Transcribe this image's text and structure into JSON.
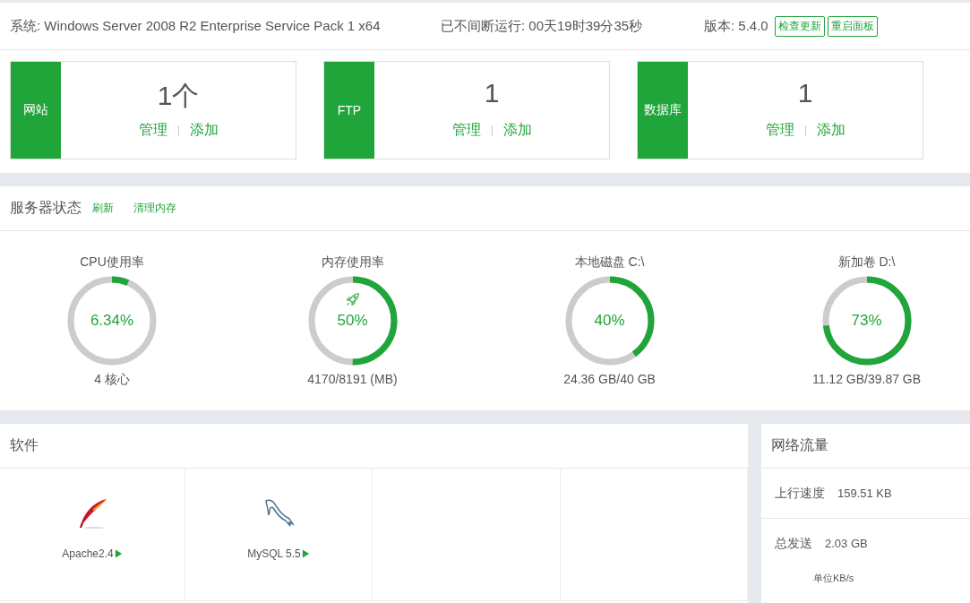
{
  "top_bar": {
    "system": "系统: Windows Server 2008 R2 Enterprise Service Pack 1 x64",
    "uptime": "已不间断运行: 00天19时39分35秒",
    "version": "版本: 5.4.0",
    "buttons": [
      "检查更新",
      "重启面板"
    ]
  },
  "summary_cards": [
    {
      "label": "网站",
      "count": "1个",
      "links": [
        "管理",
        "添加"
      ]
    },
    {
      "label": "FTP",
      "count": "1",
      "links": [
        "管理",
        "添加"
      ]
    },
    {
      "label": "数据库",
      "count": "1",
      "links": [
        "管理",
        "添加"
      ]
    }
  ],
  "server_status": {
    "title": "服务器状态",
    "actions": [
      "刷新",
      "清理内存"
    ],
    "gauges": [
      {
        "title": "CPU使用率",
        "level": 0.0634,
        "reading": "6.34%",
        "detail": "4 核心",
        "kind": "plain"
      },
      {
        "title": "内存使用率",
        "level": 0.5,
        "reading": "50%",
        "detail": "4170/8191 (MB)",
        "kind": "rocket"
      },
      {
        "title": "本地磁盘 C:\\",
        "level": 0.4,
        "reading": "40%",
        "detail": "24.36 GB/40 GB",
        "kind": "plain"
      },
      {
        "title": "新加卷 D:\\",
        "level": 0.73,
        "reading": "73%",
        "detail": "11.12 GB/39.87 GB",
        "kind": "plain"
      }
    ]
  },
  "software": {
    "title": "软件",
    "items": [
      {
        "name": "Apache2.4",
        "kind": "apache"
      },
      {
        "name": "MySQL 5.5",
        "kind": "mysql"
      },
      {
        "kind": "empty"
      },
      {
        "kind": "empty"
      }
    ]
  },
  "network": {
    "title": "网络流量",
    "rows": [
      {
        "label": "上行速度",
        "value": "159.51 KB"
      },
      {
        "label": "总发送",
        "value": "2.03 GB"
      }
    ],
    "unit": "单位KB/s"
  }
}
